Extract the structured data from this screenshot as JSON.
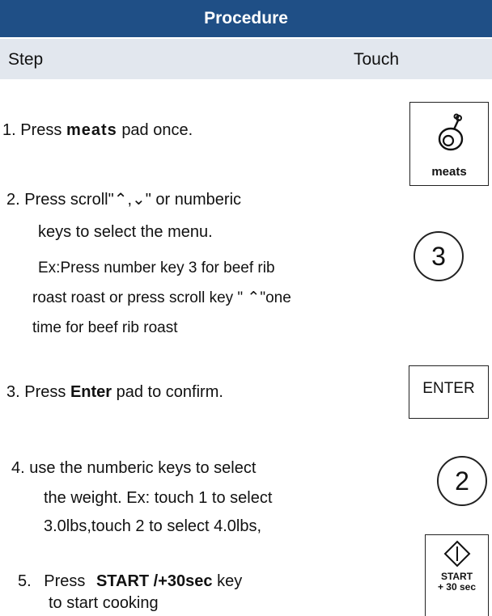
{
  "header": {
    "title": "Procedure"
  },
  "columns": {
    "step": "Step",
    "touch": "Touch"
  },
  "steps": {
    "s1": {
      "num": "1.",
      "pre": "Press",
      "key": "meats",
      "post": "pad once."
    },
    "s2": {
      "num": "2.",
      "line1": "Press scroll\"⌃,⌄\" or numberic",
      "line2": "keys to select the menu.",
      "ex1": "Ex:Press number key 3 for beef rib",
      "ex2": "roast roast or press scroll key \" ⌃\"one",
      "ex3": "time for beef rib roast"
    },
    "s3": {
      "num": "3.",
      "pre": "Press",
      "key": "Enter",
      "post": "pad to confirm."
    },
    "s4": {
      "num": "4.",
      "line1": "use the numberic keys to select",
      "line2": "the weight. Ex: touch 1 to select",
      "line3": "3.0lbs,touch 2 to select 4.0lbs,"
    },
    "s5": {
      "num": "5.",
      "pre": "Press",
      "key": "START /+30sec",
      "post": "key",
      "line2": "to start cooking"
    }
  },
  "keys": {
    "meats": {
      "label": "meats",
      "icon": "meats-icon"
    },
    "three": "3",
    "enter": "ENTER",
    "two": "2",
    "start": {
      "label": "START\n+ 30 sec",
      "icon": "start-icon"
    }
  }
}
